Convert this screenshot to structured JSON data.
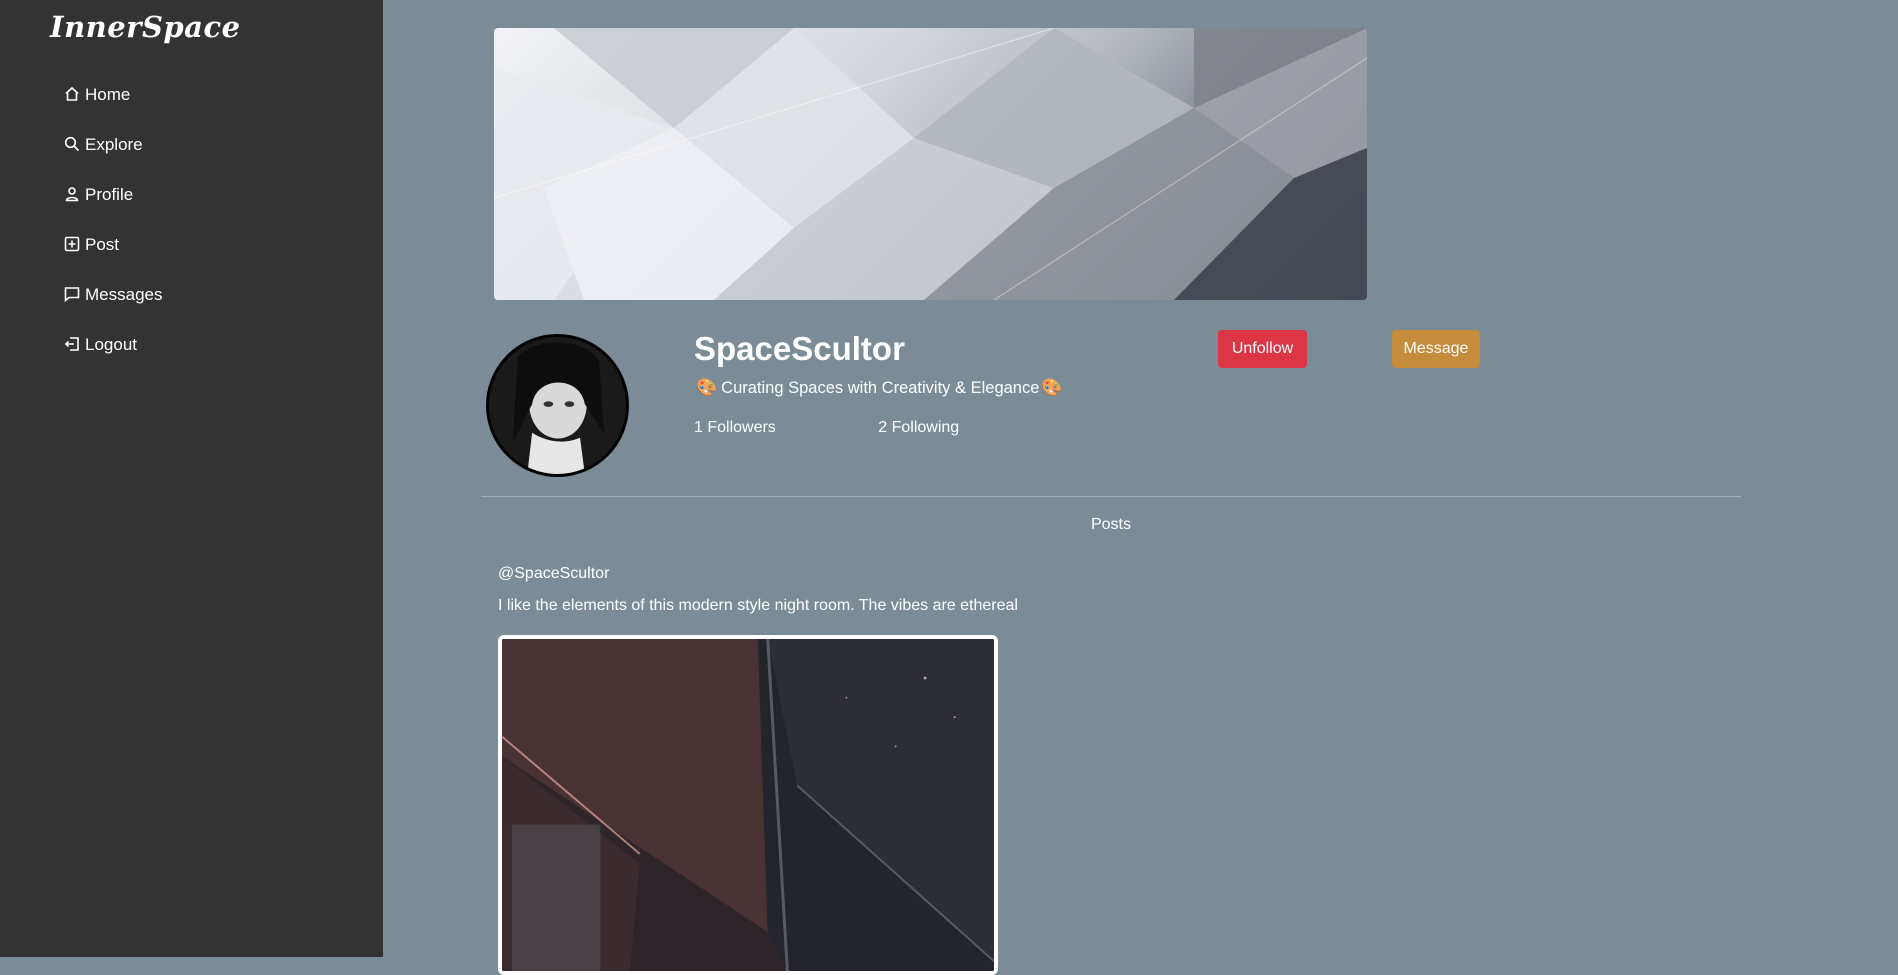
{
  "app": {
    "logo": "InnerSpace"
  },
  "sidebar": {
    "items": [
      {
        "label": "Home",
        "icon": "home-icon"
      },
      {
        "label": "Explore",
        "icon": "search-icon"
      },
      {
        "label": "Profile",
        "icon": "user-icon"
      },
      {
        "label": "Post",
        "icon": "plus-square-icon"
      },
      {
        "label": "Messages",
        "icon": "chat-icon"
      },
      {
        "label": "Logout",
        "icon": "logout-icon"
      }
    ]
  },
  "profile": {
    "username": "SpaceScultor",
    "bio_emoji": "🎨",
    "bio": "Curating Spaces with Creativity & Elegance",
    "followers": "1 Followers",
    "following": "2 Following",
    "unfollow_label": "Unfollow",
    "message_label": "Message"
  },
  "colors": {
    "sidebar": "#333333",
    "background": "#7b8c96",
    "unfollow": "#dc3545",
    "message": "#c58c3c"
  },
  "posts": {
    "section_label": "Posts",
    "items": [
      {
        "author": "@SpaceScultor",
        "text": "I like the elements of this modern style night room. The vibes are ethereal"
      }
    ]
  }
}
